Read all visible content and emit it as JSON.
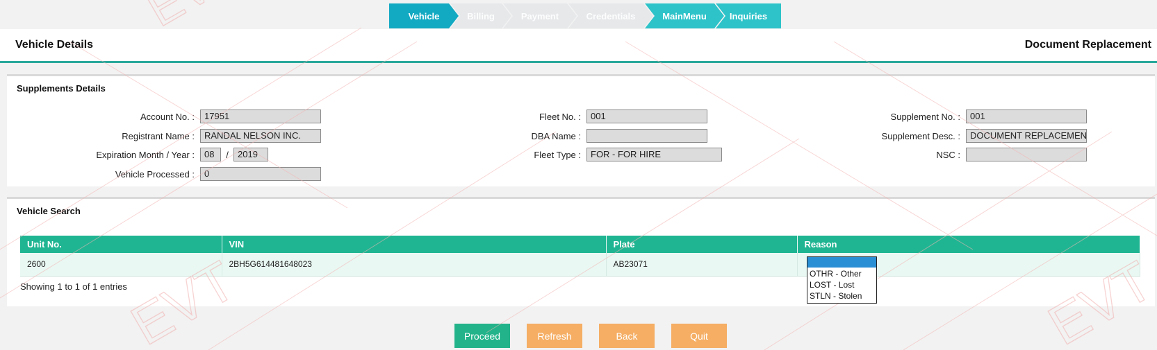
{
  "steps": [
    {
      "label": "Vehicle",
      "state": "active"
    },
    {
      "label": "Billing",
      "state": "disabled"
    },
    {
      "label": "Payment",
      "state": "disabled"
    },
    {
      "label": "Credentials",
      "state": "disabled"
    },
    {
      "label": "MainMenu",
      "state": "enabled"
    },
    {
      "label": "Inquiries",
      "state": "enabled"
    }
  ],
  "header": {
    "title": "Vehicle Details",
    "right": "Document Replacement"
  },
  "supplements": {
    "title": "Supplements Details",
    "account_label": "Account No. :",
    "account_value": "17951",
    "registrant_label": "Registrant Name :",
    "registrant_value": "RANDAL NELSON INC.",
    "expiration_label": "Expiration Month / Year :",
    "exp_month": "08",
    "exp_sep": "/",
    "exp_year": "2019",
    "processed_label": "Vehicle Processed :",
    "processed_value": "0",
    "fleet_label": "Fleet No. :",
    "fleet_value": "001",
    "dba_label": "DBA Name :",
    "dba_value": "",
    "fleet_type_label": "Fleet Type :",
    "fleet_type_value": "FOR - FOR HIRE",
    "supp_no_label": "Supplement No. :",
    "supp_no_value": "001",
    "supp_desc_label": "Supplement Desc. :",
    "supp_desc_value": "DOCUMENT REPLACEMENT",
    "nsc_label": "NSC :",
    "nsc_value": ""
  },
  "search": {
    "title": "Vehicle Search",
    "columns": [
      "Unit No.",
      "VIN",
      "Plate",
      "Reason"
    ],
    "rows": [
      {
        "unit": "2600",
        "vin": "2BH5G614481648023",
        "plate": "AB23071",
        "reason": ""
      }
    ],
    "info": "Showing 1 to 1 of 1 entries"
  },
  "reason_dropdown": {
    "selected": "",
    "options": [
      "OTHR - Other",
      "LOST - Lost",
      "STLN - Stolen"
    ]
  },
  "buttons": {
    "proceed": "Proceed",
    "refresh": "Refresh",
    "back": "Back",
    "quit": "Quit"
  },
  "colors": {
    "accent": "#12a9c2",
    "table_header": "#1fb592",
    "proceed": "#22b38a",
    "secondary": "#f5ae64"
  }
}
